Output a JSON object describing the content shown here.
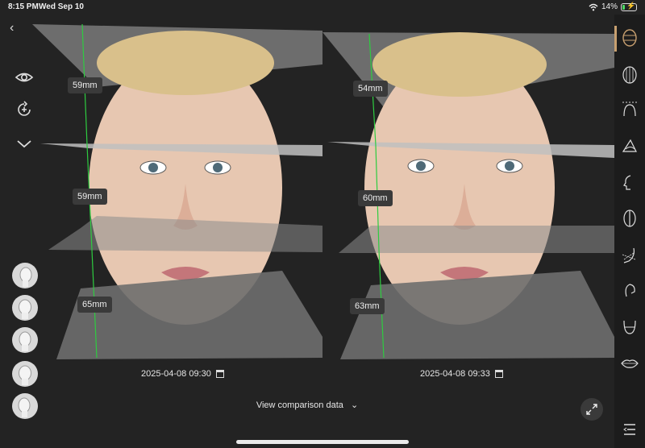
{
  "status_bar": {
    "time": "8:15 PM",
    "date": "Wed Sep 10",
    "battery": "14%",
    "battery_level": 0.14
  },
  "left_toolbar": {
    "icons": [
      "back-chevron-icon",
      "eye-icon",
      "add-rotate-icon",
      "chevron-down-icon"
    ],
    "head_views": [
      "head-right-profile",
      "head-right-three-quarter",
      "head-front",
      "head-left-three-quarter",
      "head-left-profile"
    ]
  },
  "right_toolbar": {
    "icons": [
      "face-outline-grid-icon",
      "head-mesh-icon",
      "forehead-contour-icon",
      "nose-icon",
      "face-profile-icon",
      "half-face-icon",
      "jaw-lines-icon",
      "ear-icon",
      "chin-icon",
      "lips-icon",
      "menu-lines-icon"
    ],
    "accent_color": "#c8a070"
  },
  "comparisons": [
    {
      "timestamp": "2025-04-08 09:30",
      "measurements": {
        "upper": "59mm",
        "middle": "59mm",
        "lower": "65mm"
      }
    },
    {
      "timestamp": "2025-04-08 09:33",
      "measurements": {
        "upper": "54mm",
        "middle": "60mm",
        "lower": "63mm"
      }
    }
  ],
  "footer": {
    "compare_label": "View comparison data",
    "measure_line_color": "#2ecc40"
  }
}
